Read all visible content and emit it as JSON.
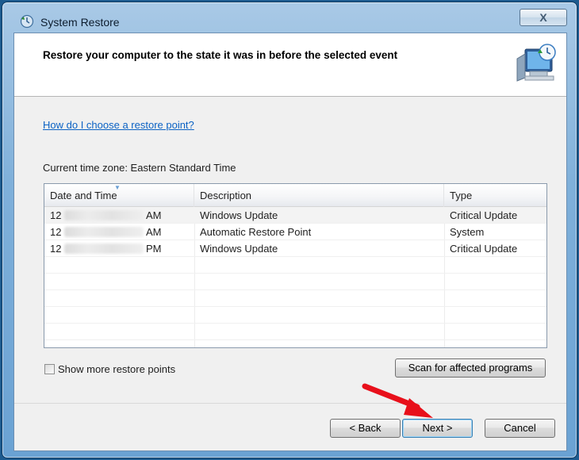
{
  "window": {
    "title": "System Restore",
    "close_label": "X"
  },
  "header": {
    "title": "Restore your computer to the state it was in before the selected event"
  },
  "help_link": "How do I choose a restore point?",
  "timezone_label": "Current time zone: Eastern Standard Time",
  "table": {
    "columns": [
      "Date and Time",
      "Description",
      "Type"
    ],
    "rows": [
      {
        "date_prefix": "12",
        "date_suffix": "AM",
        "description": "Windows Update",
        "type": "Critical Update",
        "selected": true
      },
      {
        "date_prefix": "12",
        "date_suffix": "AM",
        "description": "Automatic Restore Point",
        "type": "System",
        "selected": false
      },
      {
        "date_prefix": "12",
        "date_suffix": "PM",
        "description": "Windows Update",
        "type": "Critical Update",
        "selected": false
      }
    ]
  },
  "show_more": {
    "label": "Show more restore points",
    "checked": false
  },
  "buttons": {
    "scan": "Scan for affected programs",
    "back": "< Back",
    "next": "Next >",
    "cancel": "Cancel"
  },
  "icons": {
    "app": "system-restore-icon",
    "header": "restore-computer-icon",
    "annotation": "red-arrow-annotation"
  },
  "colors": {
    "link": "#0b62c4",
    "annotation_arrow": "#e8101b",
    "frame": "#7fb0da"
  }
}
